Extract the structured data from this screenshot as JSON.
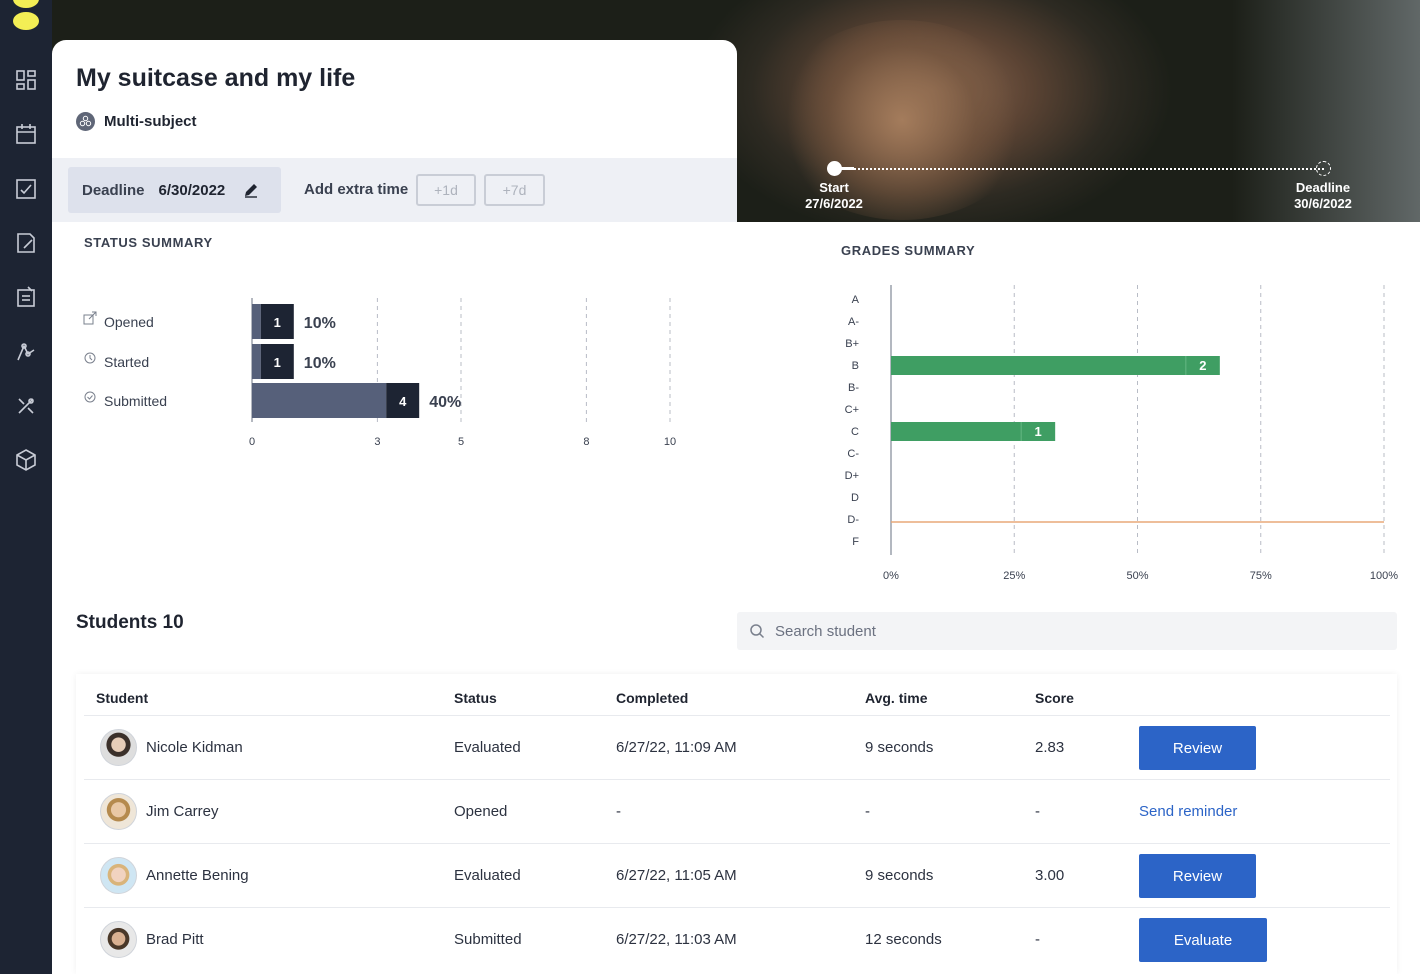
{
  "assignment": {
    "title": "My suitcase and my life",
    "subject": "Multi-subject"
  },
  "deadline": {
    "label": "Deadline",
    "value": "6/30/2022",
    "extra_time_label": "Add extra time",
    "plus1d": "+1d",
    "plus7d": "+7d"
  },
  "timeline": {
    "start_label": "Start",
    "start_date": "27/6/2022",
    "end_label": "Deadline",
    "end_date": "30/6/2022"
  },
  "status_summary": {
    "title": "STATUS SUMMARY",
    "rows": [
      {
        "label": "Opened",
        "icon": "external-link-icon"
      },
      {
        "label": "Started",
        "icon": "clock-icon"
      },
      {
        "label": "Submitted",
        "icon": "check-circle-icon"
      }
    ]
  },
  "grades_summary": {
    "title": "GRADES SUMMARY"
  },
  "chart_data": [
    {
      "type": "bar",
      "orientation": "horizontal",
      "title": "STATUS SUMMARY",
      "categories": [
        "Opened",
        "Started",
        "Submitted"
      ],
      "values": [
        1,
        1,
        4
      ],
      "data_labels": [
        "1",
        "1",
        "4"
      ],
      "percent_labels": [
        "10%",
        "10%",
        "40%"
      ],
      "x_ticks": [
        "0",
        "3",
        "5",
        "8",
        "10"
      ],
      "xlim": [
        0,
        10
      ],
      "colors": {
        "bar": "#56607a",
        "count_box": "#1d2433"
      },
      "grid": true
    },
    {
      "type": "bar",
      "orientation": "horizontal",
      "title": "GRADES SUMMARY",
      "categories": [
        "A",
        "A-",
        "B+",
        "B",
        "B-",
        "C+",
        "C",
        "C-",
        "D+",
        "D",
        "D-",
        "F"
      ],
      "values": [
        0,
        0,
        0,
        66.7,
        0,
        0,
        33.3,
        0,
        0,
        0,
        0,
        0
      ],
      "data_labels": [
        "",
        "",
        "",
        "2",
        "",
        "",
        "1",
        "",
        "",
        "",
        "",
        ""
      ],
      "x_ticks": [
        "0%",
        "25%",
        "50%",
        "75%",
        "100%"
      ],
      "xlim": [
        0,
        100
      ],
      "reference_line_position": 10.5,
      "colors": {
        "bar": "#3f9e63",
        "reference_line": "#e8a878"
      },
      "grid": true
    }
  ],
  "students": {
    "title": "Students 10",
    "search_placeholder": "Search student",
    "columns": [
      "Student",
      "Status",
      "Completed",
      "Avg. time",
      "Score"
    ],
    "rows": [
      {
        "name": "Nicole Kidman",
        "status": "Evaluated",
        "completed": "6/27/22, 11:09 AM",
        "avg_time": "9 seconds",
        "score": "2.83",
        "action": "Review"
      },
      {
        "name": "Jim Carrey",
        "status": "Opened",
        "completed": "-",
        "avg_time": "-",
        "score": "-",
        "action": "Send reminder"
      },
      {
        "name": "Annette Bening",
        "status": "Evaluated",
        "completed": "6/27/22, 11:05 AM",
        "avg_time": "9 seconds",
        "score": "3.00",
        "action": "Review"
      },
      {
        "name": "Brad Pitt",
        "status": "Submitted",
        "completed": "6/27/22, 11:03 AM",
        "avg_time": "12 seconds",
        "score": "-",
        "action": "Evaluate"
      }
    ]
  },
  "sidebar": {
    "icons": [
      "dashboard-icon",
      "calendar-icon",
      "tasks-icon",
      "notes-icon",
      "assignments-icon",
      "mindmap-icon",
      "tools-icon",
      "box-icon"
    ]
  },
  "colors": {
    "accent": "#2c64c7",
    "sidebar": "#1d2433",
    "logo": "#f3ee55"
  }
}
